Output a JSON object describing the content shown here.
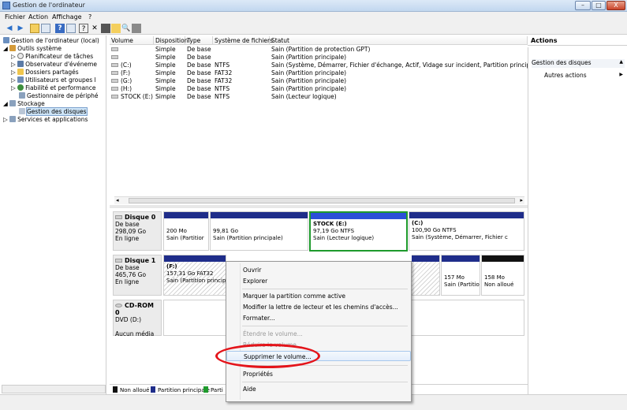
{
  "window": {
    "title": "Gestion de l'ordinateur",
    "buttons": [
      "–",
      "□",
      "X"
    ]
  },
  "menu": [
    "Fichier",
    "Action",
    "Affichage",
    "?"
  ],
  "toolbar": {
    "icons": [
      "back-arrow-icon",
      "forward-arrow-icon",
      "up-folder-icon",
      "show-tree-icon",
      "help-icon",
      "properties-icon",
      "help-doc-icon",
      "delete-icon",
      "open-icon",
      "folder-icon",
      "search-icon",
      "disk-icon"
    ]
  },
  "tree": [
    {
      "label": "Gestion de l'ordinateur (local)",
      "indent": 0
    },
    {
      "label": "Outils système",
      "indent": 1
    },
    {
      "label": "Planificateur de tâches",
      "indent": 2
    },
    {
      "label": "Observateur d'événeme",
      "indent": 2
    },
    {
      "label": "Dossiers partagés",
      "indent": 2
    },
    {
      "label": "Utilisateurs et groupes l",
      "indent": 2
    },
    {
      "label": "Fiabilité et performance",
      "indent": 2
    },
    {
      "label": "Gestionnaire de périphé",
      "indent": 2
    },
    {
      "label": "Stockage",
      "indent": 1
    },
    {
      "label": "Gestion des disques",
      "indent": 2
    },
    {
      "label": "Services et applications",
      "indent": 1
    }
  ],
  "volume_columns": [
    "Volume",
    "Disposition",
    "Type",
    "Système de fichiers",
    "Statut"
  ],
  "volumes": [
    {
      "volume": "",
      "disposition": "Simple",
      "type": "De base",
      "fs": "",
      "status": "Sain (Partition de protection GPT)"
    },
    {
      "volume": "",
      "disposition": "Simple",
      "type": "De base",
      "fs": "",
      "status": "Sain (Partition principale)"
    },
    {
      "volume": "(C:)",
      "disposition": "Simple",
      "type": "De base",
      "fs": "NTFS",
      "status": "Sain (Système, Démarrer, Fichier d'échange, Actif, Vidage sur incident, Partition principale"
    },
    {
      "volume": "(F:)",
      "disposition": "Simple",
      "type": "De base",
      "fs": "FAT32",
      "status": "Sain (Partition principale)"
    },
    {
      "volume": "(G:)",
      "disposition": "Simple",
      "type": "De base",
      "fs": "FAT32",
      "status": "Sain (Partition principale)"
    },
    {
      "volume": "(H:)",
      "disposition": "Simple",
      "type": "De base",
      "fs": "NTFS",
      "status": "Sain (Partition principale)"
    },
    {
      "volume": "STOCK (E:)",
      "disposition": "Simple",
      "type": "De base",
      "fs": "NTFS",
      "status": "Sain (Lecteur logique)"
    }
  ],
  "disks": {
    "disk0": {
      "name": "Disque 0",
      "type": "De base",
      "size": "298,09 Go",
      "state": "En ligne",
      "parts": [
        {
          "l1": "200 Mo",
          "l2": "Sain (Partitior"
        },
        {
          "l1": "99,81 Go",
          "l2": "Sain (Partition principale)"
        },
        {
          "title": "STOCK (E:)",
          "l1": "97,19 Go NTFS",
          "l2": "Sain (Lecteur logique)"
        },
        {
          "title": "(C:)",
          "l1": "100,90 Go NTFS",
          "l2": "Sain (Système, Démarrer, Fichier c"
        }
      ]
    },
    "disk1": {
      "name": "Disque 1",
      "type": "De base",
      "size": "465,76 Go",
      "state": "En ligne",
      "parts": [
        {
          "title": "(F:)",
          "l1": "157,31 Go FAT32",
          "l2": "Sain (Partition princip"
        },
        {
          "l1": "157 Mo",
          "l2": "Sain (Partitio"
        },
        {
          "l1": "158 Mo",
          "l2": "Non alloué"
        }
      ]
    },
    "cdrom0": {
      "name": "CD-ROM 0",
      "type": "DVD (D:)",
      "state": "Aucun média"
    }
  },
  "legend": [
    "Non alloué",
    "Partition principale",
    "Parti"
  ],
  "actions": {
    "header": "Actions",
    "section": "Gestion des disques",
    "items": [
      "Autres actions"
    ]
  },
  "context_menu": [
    {
      "label": "Ouvrir",
      "disabled": false
    },
    {
      "label": "Explorer",
      "disabled": false
    },
    {
      "label": "Marquer la partition comme active",
      "disabled": false
    },
    {
      "label": "Modifier la lettre de lecteur et les chemins d'accès...",
      "disabled": false
    },
    {
      "label": "Formater...",
      "disabled": false
    },
    {
      "label": "Étendre le volume...",
      "disabled": true
    },
    {
      "label": "Réduire le volume...",
      "disabled": true
    },
    {
      "label": "Supprimer le volume...",
      "disabled": false
    },
    {
      "label": "Propriétés",
      "disabled": false
    },
    {
      "label": "Aide",
      "disabled": false
    }
  ],
  "colors": {
    "primary_partition": "#1f2d8a",
    "selected_border": "#1e9a2c",
    "logical_drive": "#2b4fd8",
    "highlight_oval": "#e4141a",
    "unallocated": "#111111"
  }
}
